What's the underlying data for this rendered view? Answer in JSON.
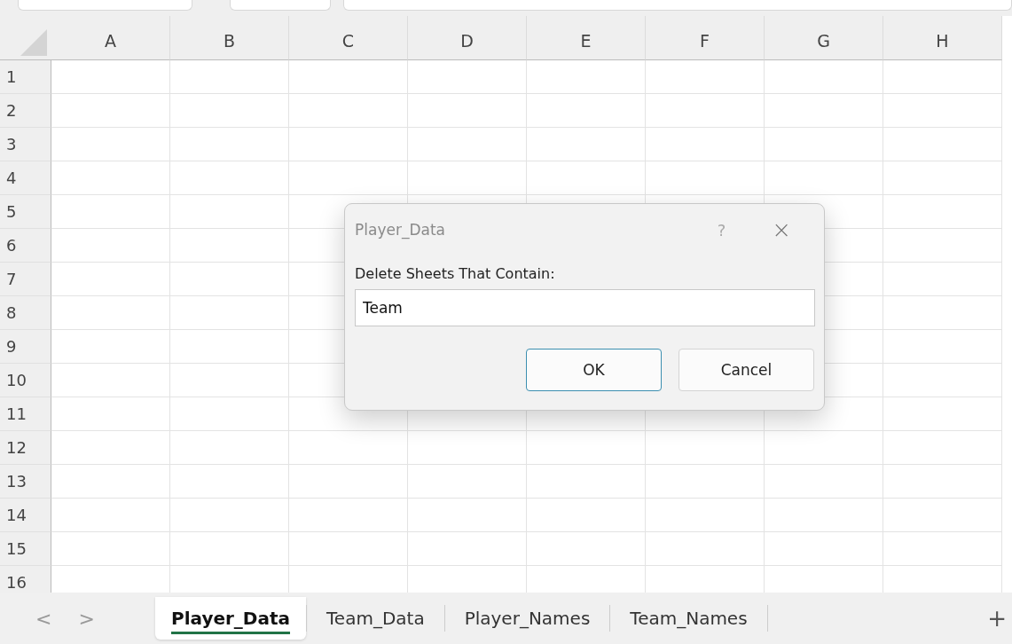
{
  "columns": [
    "A",
    "B",
    "C",
    "D",
    "E",
    "F",
    "G",
    "H"
  ],
  "rows": [
    "1",
    "2",
    "3",
    "4",
    "5",
    "6",
    "7",
    "8",
    "9",
    "10",
    "11",
    "12",
    "13",
    "14",
    "15",
    "16"
  ],
  "dialog": {
    "title": "Player_Data",
    "help": "?",
    "close": "×",
    "label": "Delete Sheets That Contain:",
    "value": "Team",
    "buttons": [
      {
        "label": "OK",
        "kind": "default"
      },
      {
        "label": "Cancel",
        "kind": "normal"
      }
    ]
  },
  "sheet_nav": [
    "<",
    ">"
  ],
  "sheet_tabs": [
    {
      "label": "Player_Data",
      "selected": true
    },
    {
      "label": "Team_Data",
      "selected": false
    },
    {
      "label": "Player_Names",
      "selected": false
    },
    {
      "label": "Team_Names",
      "selected": false
    }
  ],
  "add_sheet": "+"
}
